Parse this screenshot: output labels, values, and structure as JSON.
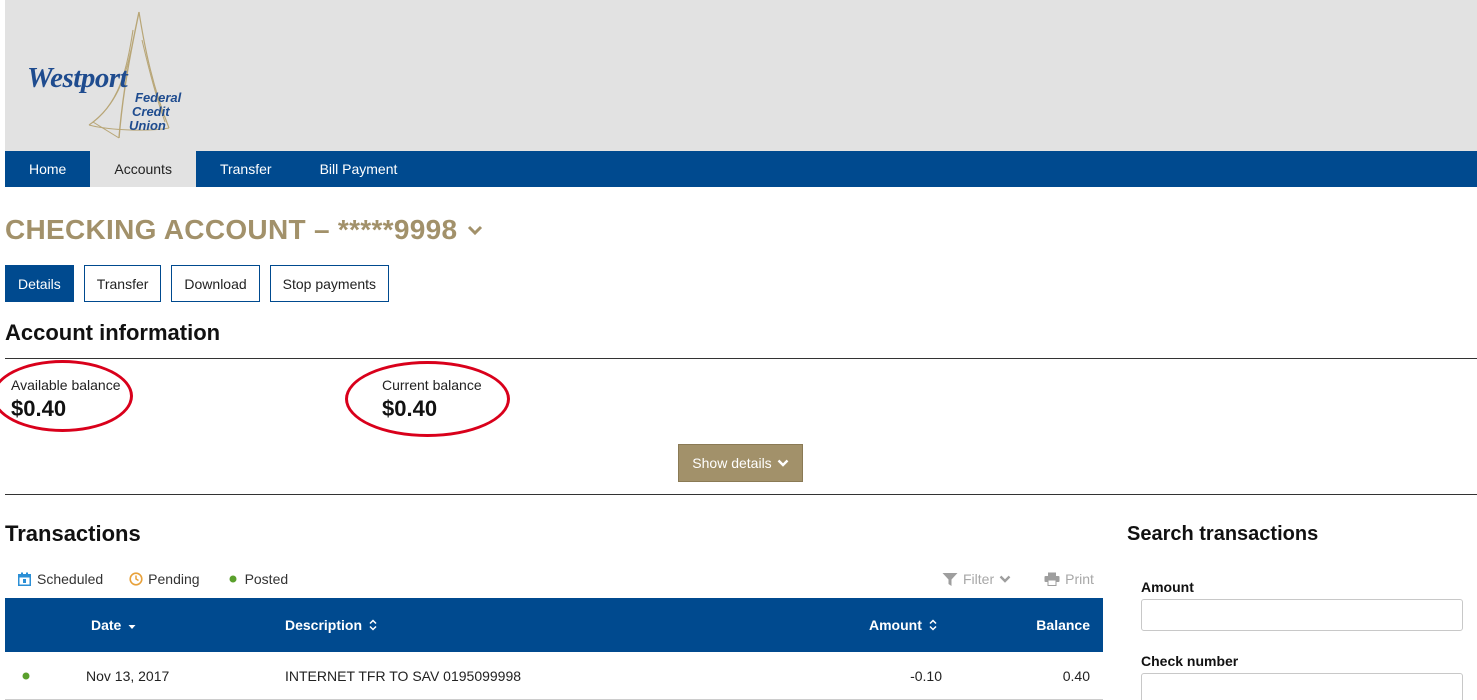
{
  "brand": {
    "name": "Westport",
    "sub_line1": "Federal",
    "sub_line2": "Credit",
    "sub_line3": "Union",
    "color": "#1f4c8f",
    "accent": "#a2916a"
  },
  "nav": {
    "items": [
      {
        "label": "Home",
        "active": false
      },
      {
        "label": "Accounts",
        "active": true
      },
      {
        "label": "Transfer",
        "active": false
      },
      {
        "label": "Bill Payment",
        "active": false
      }
    ]
  },
  "account": {
    "title": "CHECKING ACCOUNT – *****9998",
    "actions": [
      {
        "label": "Details",
        "active": true
      },
      {
        "label": "Transfer",
        "active": false
      },
      {
        "label": "Download",
        "active": false
      },
      {
        "label": "Stop payments",
        "active": false
      }
    ]
  },
  "account_info": {
    "heading": "Account information",
    "available_label": "Available balance",
    "available_value": "$0.40",
    "current_label": "Current balance",
    "current_value": "$0.40",
    "show_details_label": "Show details",
    "highlight_color": "#d9001b"
  },
  "transactions": {
    "heading": "Transactions",
    "legend": {
      "scheduled": "Scheduled",
      "pending": "Pending",
      "posted": "Posted"
    },
    "filter_label": "Filter",
    "print_label": "Print",
    "columns": {
      "date": "Date",
      "description": "Description",
      "amount": "Amount",
      "balance": "Balance"
    },
    "rows": [
      {
        "status": "posted",
        "date": "Nov 13, 2017",
        "description": "INTERNET TFR TO SAV 0195099998",
        "amount": "-0.10",
        "balance": "0.40"
      }
    ]
  },
  "search": {
    "heading": "Search transactions",
    "amount_label": "Amount",
    "amount_value": "",
    "check_label": "Check number",
    "check_value": ""
  },
  "colors": {
    "nav_bg": "#004a8f",
    "header_bg": "#e2e2e2",
    "posted": "#5aa02c",
    "pending": "#e8a13a",
    "scheduled": "#2b8fd6"
  }
}
